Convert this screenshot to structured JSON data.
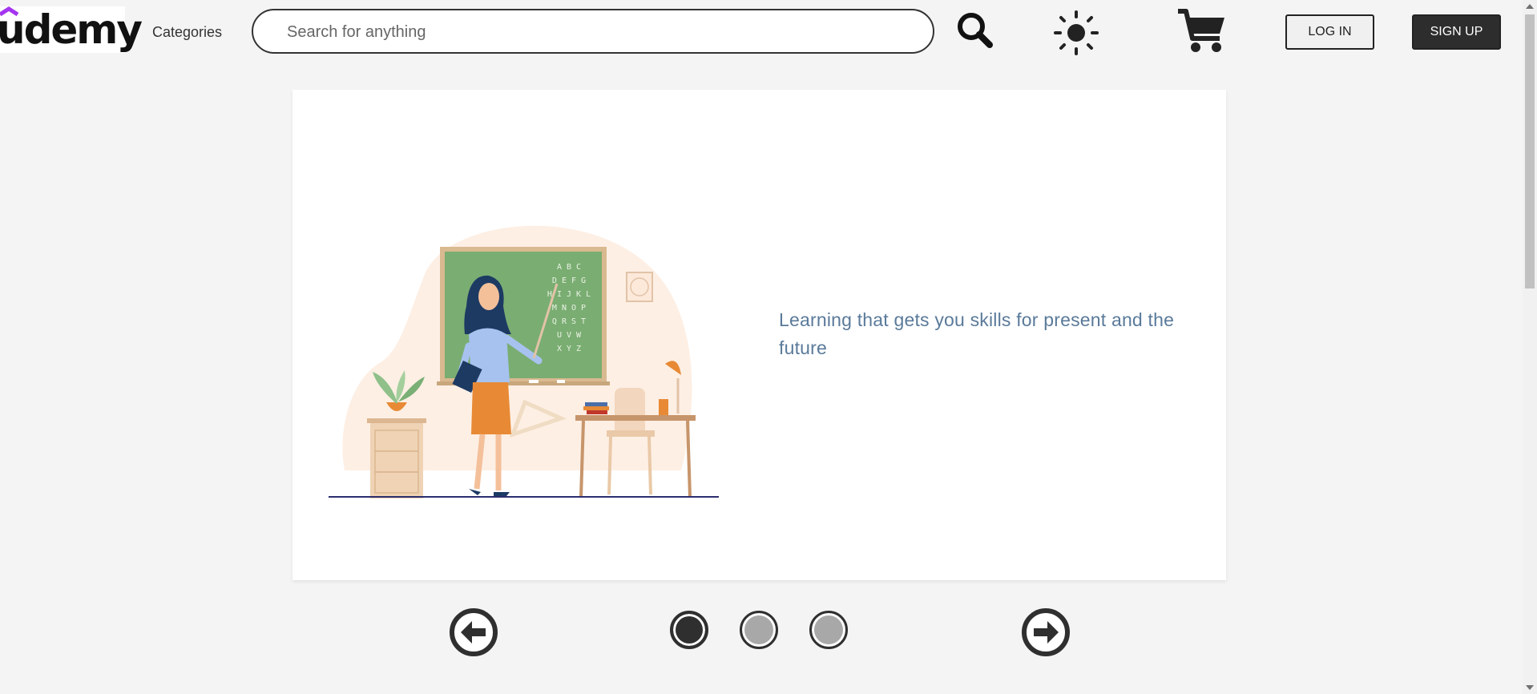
{
  "brand": {
    "logo_text": "udemy",
    "accent": "#a435f0"
  },
  "header": {
    "categories_label": "Categories",
    "search_placeholder": "Search for anything",
    "search_icon": "search-icon",
    "theme_icon": "sun-icon",
    "cart_icon": "cart-icon",
    "login_label": "LOG IN",
    "signup_label": "SIGN UP"
  },
  "hero": {
    "tagline": "Learning that gets you skills for present and the future",
    "chalkboard_lines": [
      "A B C",
      "D E F G",
      "H I J K L",
      "M N O P",
      "Q R S T",
      "U V W",
      "X Y Z"
    ]
  },
  "carousel": {
    "prev_icon": "arrow-left-circle-icon",
    "next_icon": "arrow-right-circle-icon",
    "slides": 3,
    "active_slide": 1
  }
}
